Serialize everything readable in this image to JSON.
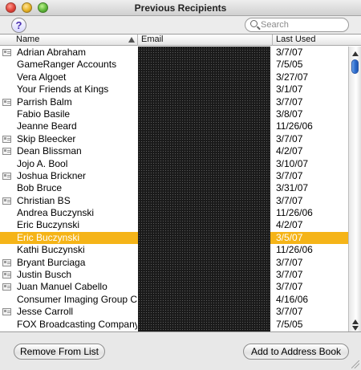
{
  "window": {
    "title": "Previous Recipients"
  },
  "toolbar": {
    "help_label": "?",
    "search_placeholder": "Search"
  },
  "table": {
    "columns": {
      "name": "Name",
      "email": "Email",
      "last_used": "Last Used"
    },
    "rows": [
      {
        "name": "Adrian Abraham",
        "date": "3/7/07",
        "card": true
      },
      {
        "name": "GameRanger Accounts",
        "date": "7/5/05",
        "card": false
      },
      {
        "name": "Vera Algoet",
        "date": "3/27/07",
        "card": false
      },
      {
        "name": "Your Friends at Kings",
        "date": "3/1/07",
        "card": false
      },
      {
        "name": "Parrish Balm",
        "date": "3/7/07",
        "card": true
      },
      {
        "name": "Fabio Basile",
        "date": "3/8/07",
        "card": false
      },
      {
        "name": "Jeanne Beard",
        "date": "11/26/06",
        "card": false
      },
      {
        "name": "Skip Bleecker",
        "date": "3/7/07",
        "card": true
      },
      {
        "name": "Dean Blissman",
        "date": "4/2/07",
        "card": true
      },
      {
        "name": "Jojo A. Bool",
        "date": "3/10/07",
        "card": false
      },
      {
        "name": "Joshua Brickner",
        "date": "3/7/07",
        "card": true
      },
      {
        "name": "Bob Bruce",
        "date": "3/31/07",
        "card": false
      },
      {
        "name": "Christian BS",
        "date": "3/7/07",
        "card": true
      },
      {
        "name": "Andrea Buczynski",
        "date": "11/26/06",
        "card": false
      },
      {
        "name": "Eric Buczynski",
        "date": "4/2/07",
        "card": false
      },
      {
        "name": "Eric Buczynski",
        "date": "3/5/07",
        "card": false,
        "selected": true
      },
      {
        "name": "Kathi Buczynski",
        "date": "11/26/06",
        "card": false
      },
      {
        "name": "Bryant Burciaga",
        "date": "3/7/07",
        "card": true
      },
      {
        "name": "Justin Busch",
        "date": "3/7/07",
        "card": true
      },
      {
        "name": "Juan Manuel Cabello",
        "date": "3/7/07",
        "card": true
      },
      {
        "name": "Consumer Imaging Group Car",
        "date": "4/16/06",
        "card": false
      },
      {
        "name": "Jesse Carroll",
        "date": "3/7/07",
        "card": true
      },
      {
        "name": "FOX Broadcasting Company",
        "date": "7/5/05",
        "card": false
      }
    ]
  },
  "buttons": {
    "remove": "Remove From List",
    "add": "Add to Address Book"
  },
  "colors": {
    "selection": "#f5b418"
  },
  "icons": {
    "card": "address-card-icon",
    "help": "help-icon",
    "search": "search-icon"
  }
}
